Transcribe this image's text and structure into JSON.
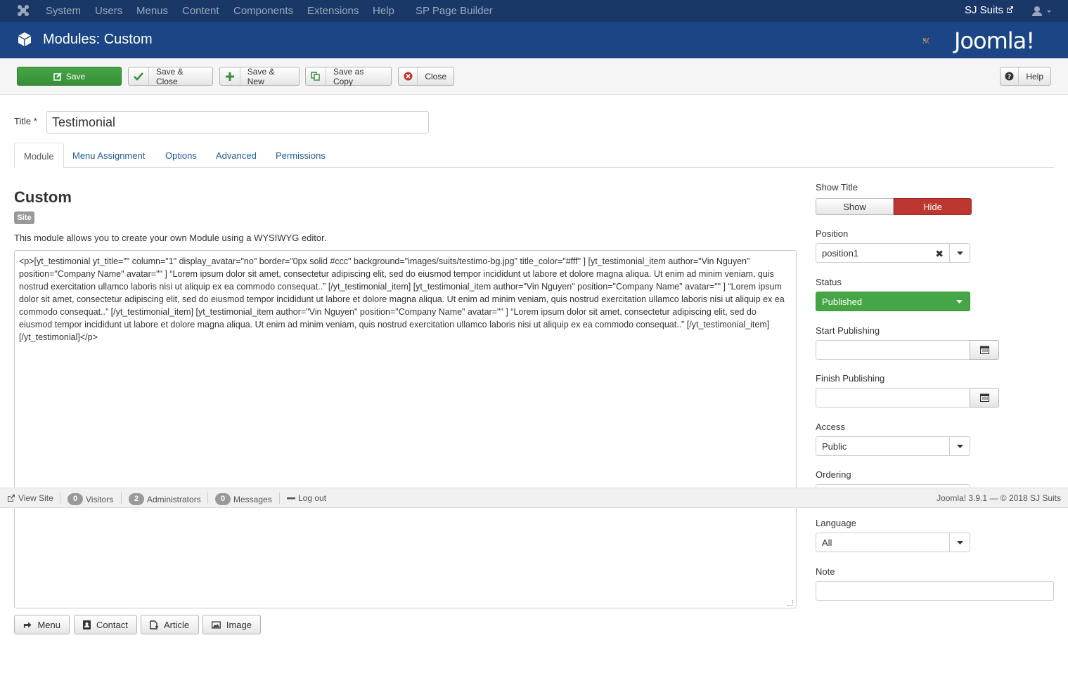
{
  "topbar": {
    "menu": [
      "System",
      "Users",
      "Menus",
      "Content",
      "Components",
      "Extensions",
      "Help",
      "SP Page Builder"
    ],
    "site_name": "SJ Suits"
  },
  "header": {
    "title": "Modules: Custom",
    "logo": "Joomla!"
  },
  "toolbar": {
    "save": "Save",
    "save_close": "Save & Close",
    "save_new": "Save & New",
    "save_copy": "Save as Copy",
    "close": "Close",
    "help": "Help"
  },
  "form": {
    "title_label": "Title *",
    "title_value": "Testimonial"
  },
  "tabs": [
    "Module",
    "Menu Assignment",
    "Options",
    "Advanced",
    "Permissions"
  ],
  "module": {
    "name": "Custom",
    "badge": "Site",
    "description": "This module allows you to create your own Module using a WYSIWYG editor.",
    "content": "<p>[yt_testimonial yt_title=\"\" column=\"1\" display_avatar=\"no\" border=\"0px solid #ccc\" background=\"images/suits/testimo-bg.jpg\" title_color=\"#fff\" ] [yt_testimonial_item author=\"Vin Nguyen\" position=\"Company Name\" avatar=\"\" ] “Lorem ipsum dolor sit amet, consectetur adipiscing elit, sed do eiusmod tempor incididunt ut labore et dolore magna aliqua. Ut enim ad minim veniam, quis nostrud exercitation ullamco laboris nisi ut aliquip ex ea commodo consequat..” [/yt_testimonial_item] [yt_testimonial_item author=\"Vin Nguyen\" position=\"Company Name\" avatar=\"\" ] “Lorem ipsum dolor sit amet, consectetur adipiscing elit, sed do eiusmod tempor incididunt ut labore et dolore magna aliqua. Ut enim ad minim veniam, quis nostrud exercitation ullamco laboris nisi ut aliquip ex ea commodo consequat..” [/yt_testimonial_item] [yt_testimonial_item author=\"Vin Nguyen\" position=\"Company Name\" avatar=\"\" ] “Lorem ipsum dolor sit amet, consectetur adipiscing elit, sed do eiusmod tempor incididunt ut labore et dolore magna aliqua. Ut enim ad minim veniam, quis nostrud exercitation ullamco laboris nisi ut aliquip ex ea commodo consequat..” [/yt_testimonial_item] [/yt_testimonial]</p>"
  },
  "editor_buttons": [
    "Menu",
    "Contact",
    "Article",
    "Image"
  ],
  "sidebar": {
    "show_title_label": "Show Title",
    "show": "Show",
    "hide": "Hide",
    "position_label": "Position",
    "position_value": "position1",
    "status_label": "Status",
    "status_value": "Published",
    "start_publishing_label": "Start Publishing",
    "finish_publishing_label": "Finish Publishing",
    "access_label": "Access",
    "access_value": "Public",
    "ordering_label": "Ordering",
    "language_label": "Language",
    "language_value": "All",
    "note_label": "Note"
  },
  "statusbar": {
    "view_site": "View Site",
    "visitors_count": "0",
    "visitors": "Visitors",
    "admins_count": "2",
    "admins": "Administrators",
    "messages_count": "0",
    "messages": "Messages",
    "logout": "Log out",
    "version": "Joomla! 3.9.1 — © 2018 SJ Suits"
  },
  "colors": {
    "topbar": "#1a3867",
    "header": "#1c4585",
    "save_green": "#46a546",
    "hide_red": "#bd362f",
    "link_blue": "#1f5a9e"
  }
}
